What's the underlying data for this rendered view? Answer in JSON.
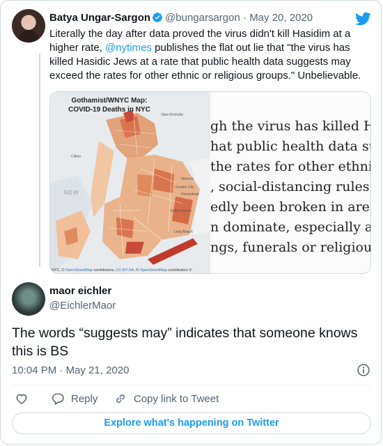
{
  "parent_tweet": {
    "author_name": "Batya Ungar-Sargon",
    "handle": "@bungarsargon",
    "separator": "·",
    "date": "May 20, 2020",
    "text_before": "Literally the day after data proved the virus didn't kill Hasidim at a higher rate, ",
    "mention": "@nytimes",
    "text_after": " publishes the flat out lie that \"the virus has killed Hasidic Jews at a rate that public health data suggests may exceed the rates for other ethnic or religious groups.\" Unbelievable.",
    "media": {
      "map_title_line1": "Gothamist/WNYC Map:",
      "map_title_line2": "COVID-19 Deaths in NYC",
      "map_credit_prefix": "NYC, © ",
      "map_credit_link1": "OpenStreetMap",
      "map_credit_mid": " contributors, ",
      "map_credit_link2": "CC-BY-SA",
      "map_credit_mid2": ", © ",
      "map_credit_link3": "OpenStreetMap",
      "map_credit_suffix": " contributors ©",
      "map_labels": [
        "New Rochelle",
        "Clifton",
        "Minerva",
        "Garden City",
        "Hempstead",
        "Valley Stream",
        "Long Beach",
        "NEW"
      ],
      "article_lines": [
        "gh the virus has killed Ha",
        "hat public health data su",
        " the rates for other ethnic",
        ", social-distancing rules h",
        "edly been broken in areas",
        "n dominate, especially at",
        "ngs, funerals or religious g"
      ]
    }
  },
  "reply_tweet": {
    "author_name": "maor eichler",
    "handle": "@EichlerMaor",
    "text": "The words “suggests may” indicates that someone knows this is BS",
    "time": "10:04 PM",
    "separator": "·",
    "date": "May 21, 2020"
  },
  "actions": {
    "reply_label": "Reply",
    "copy_link_label": "Copy link to Tweet"
  },
  "explore_label": "Explore what's happening on Twitter",
  "colors": {
    "twitter_blue": "#1d9bf0",
    "text_primary": "#0f1419",
    "text_secondary": "#536471",
    "border": "#cfd9de"
  },
  "icons": [
    "verified-badge-icon",
    "twitter-bird-icon",
    "info-icon",
    "heart-icon",
    "reply-bubble-icon",
    "copy-link-icon"
  ]
}
